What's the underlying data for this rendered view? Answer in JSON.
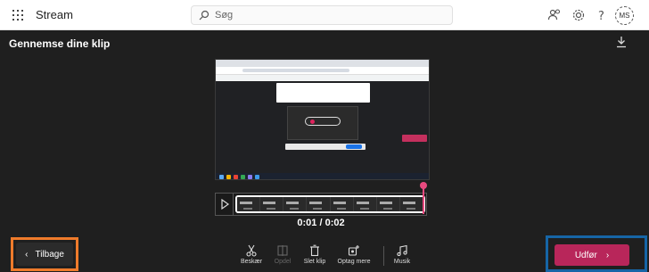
{
  "topbar": {
    "app_name": "Stream",
    "search_placeholder": "Søg",
    "avatar_initials": "MS"
  },
  "editor": {
    "page_title": "Gennemse dine klip",
    "time_display": "0:01 / 0:02",
    "back_label": "Tilbage",
    "done_label": "Udfør"
  },
  "tools": [
    {
      "label": "Beskær",
      "icon": "scissors-icon",
      "enabled": true
    },
    {
      "label": "Opdel",
      "icon": "split-icon",
      "enabled": false
    },
    {
      "label": "Slet klip",
      "icon": "trash-icon",
      "enabled": true
    },
    {
      "label": "Optag mere",
      "icon": "record-more-icon",
      "enabled": true
    },
    {
      "label": "Musik",
      "icon": "music-icon",
      "enabled": true
    }
  ],
  "colors": {
    "accent": "#b8265a",
    "playhead": "#e84a7f",
    "highlight_orange": "#ef7b2b",
    "highlight_blue": "#1665a6"
  }
}
